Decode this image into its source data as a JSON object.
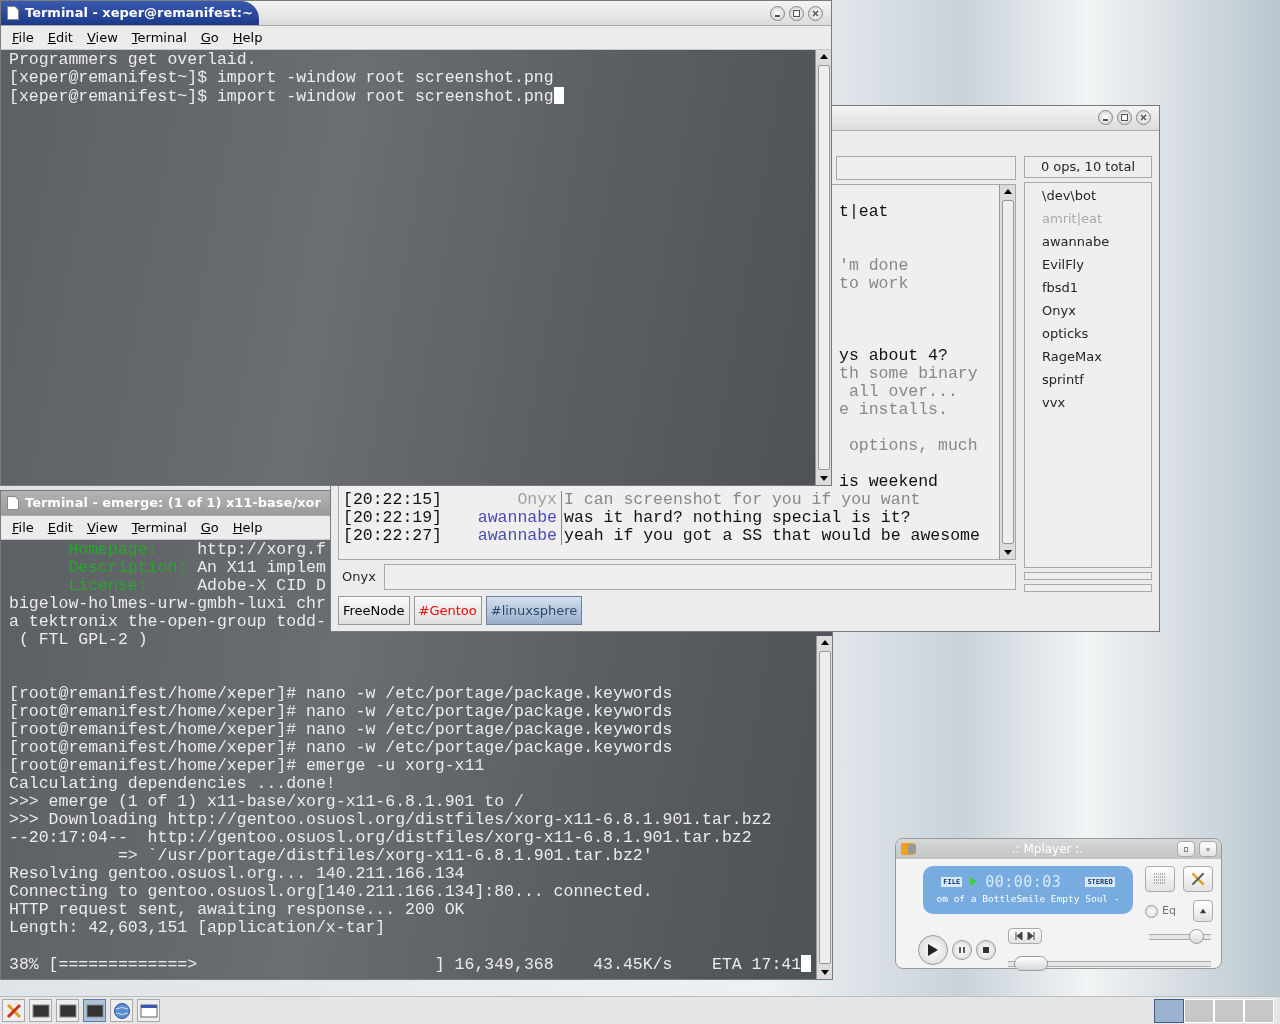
{
  "terminal_top": {
    "title": "Terminal - xeper@remanifest:~",
    "active": true,
    "menu": [
      "File",
      "Edit",
      "View",
      "Terminal",
      "Go",
      "Help"
    ],
    "lines": [
      {
        "kind": "text",
        "text": "Programmers get overlaid.",
        "cursor": false
      },
      {
        "kind": "text",
        "text": "[xeper@remanifest~]$ import -window root screenshot.png",
        "cursor": false
      },
      {
        "kind": "text",
        "text": "[xeper@remanifest~]$ import -window root screenshot.png",
        "cursor": true
      }
    ]
  },
  "irc": {
    "user_count": "0 ops, 10 total",
    "users": [
      {
        "name": "\\dev\\bot",
        "away": false
      },
      {
        "name": "amrit|eat",
        "away": true
      },
      {
        "name": "awannabe",
        "away": false
      },
      {
        "name": "EvilFly",
        "away": false
      },
      {
        "name": "fbsd1",
        "away": false
      },
      {
        "name": "Onyx",
        "away": false
      },
      {
        "name": "opticks",
        "away": false
      },
      {
        "name": "RageMax",
        "away": false
      },
      {
        "name": "sprintf",
        "away": false
      },
      {
        "name": "vvx",
        "away": false
      }
    ],
    "lines": [
      {
        "kind": "blank"
      },
      {
        "kind": "fragment",
        "text": "t|eat",
        "dim": false
      },
      {
        "kind": "blank"
      },
      {
        "kind": "blank"
      },
      {
        "kind": "fragment",
        "text": "'m done",
        "dim": true
      },
      {
        "kind": "fragment",
        "text": "to work",
        "dim": true
      },
      {
        "kind": "blank"
      },
      {
        "kind": "blank"
      },
      {
        "kind": "blank"
      },
      {
        "kind": "fragment",
        "text": "ys about 4?",
        "dim": false
      },
      {
        "kind": "fragment",
        "text": "th some binary",
        "dim": true
      },
      {
        "kind": "fragment",
        "text": " all over...",
        "dim": true
      },
      {
        "kind": "fragment",
        "text": "e installs.",
        "dim": true
      },
      {
        "kind": "blank"
      },
      {
        "kind": "fragment",
        "text": " options, much",
        "dim": true
      },
      {
        "kind": "blank"
      },
      {
        "kind": "fragment",
        "text": "is weekend",
        "dim": false
      },
      {
        "kind": "message",
        "time": "[20:22:15]",
        "nick": "Onyx",
        "color": "#a0a0a0",
        "text": "I can screenshot for you if you want",
        "dim": true
      },
      {
        "kind": "message",
        "time": "[20:22:19]",
        "nick": "awannabe",
        "color": "#4a4ab8",
        "text": "was it hard? nothing special is it?",
        "dim": false
      },
      {
        "kind": "message",
        "time": "[20:22:27]",
        "nick": "awannabe",
        "color": "#4a4ab8",
        "text": "yeah if you got a SS that would be awesome",
        "dim": false
      }
    ],
    "input_nick": "Onyx",
    "tabs": [
      {
        "label": "FreeNode",
        "selected": false,
        "color": "#000000"
      },
      {
        "label": "#Gentoo",
        "selected": false,
        "color": "#ff0000"
      },
      {
        "label": "#linuxsphere",
        "selected": true,
        "color": "#2c4a6e"
      }
    ]
  },
  "terminal_bottom": {
    "title": "Terminal - emerge: (1 of 1) x11-base/xor",
    "active": false,
    "menu": [
      "File",
      "Edit",
      "View",
      "Terminal",
      "Go",
      "Help"
    ],
    "lines": [
      {
        "kind": "field",
        "label": "Homepage:",
        "value": "http://xorg.f"
      },
      {
        "kind": "field",
        "label": "Description:",
        "value": "An X11 implem"
      },
      {
        "kind": "field",
        "label": "License:",
        "value": "Adobe-X CID D"
      },
      {
        "kind": "text",
        "text": "bigelow-holmes-urw-gmbh-luxi chr",
        "cursor": false
      },
      {
        "kind": "text",
        "text": "a tektronix the-open-group todd-",
        "cursor": false
      },
      {
        "kind": "text",
        "text": " ( FTL GPL-2 )",
        "cursor": false
      },
      {
        "kind": "blank"
      },
      {
        "kind": "blank"
      },
      {
        "kind": "text",
        "text": "[root@remanifest/home/xeper]# nano -w /etc/portage/package.keywords",
        "cursor": false
      },
      {
        "kind": "text",
        "text": "[root@remanifest/home/xeper]# nano -w /etc/portage/package.keywords",
        "cursor": false
      },
      {
        "kind": "text",
        "text": "[root@remanifest/home/xeper]# nano -w /etc/portage/package.keywords",
        "cursor": false
      },
      {
        "kind": "text",
        "text": "[root@remanifest/home/xeper]# nano -w /etc/portage/package.keywords",
        "cursor": false
      },
      {
        "kind": "text",
        "text": "[root@remanifest/home/xeper]# emerge -u xorg-x11",
        "cursor": false
      },
      {
        "kind": "text",
        "text": "Calculating dependencies ...done!",
        "cursor": false
      },
      {
        "kind": "text",
        "text": ">>> emerge (1 of 1) x11-base/xorg-x11-6.8.1.901 to /",
        "cursor": false
      },
      {
        "kind": "text",
        "text": ">>> Downloading http://gentoo.osuosl.org/distfiles/xorg-x11-6.8.1.901.tar.bz2",
        "cursor": false
      },
      {
        "kind": "text",
        "text": "--20:17:04--  http://gentoo.osuosl.org/distfiles/xorg-x11-6.8.1.901.tar.bz2",
        "cursor": false
      },
      {
        "kind": "text",
        "text": "           => `/usr/portage/distfiles/xorg-x11-6.8.1.901.tar.bz2'",
        "cursor": false
      },
      {
        "kind": "text",
        "text": "Resolving gentoo.osuosl.org... 140.211.166.134",
        "cursor": false
      },
      {
        "kind": "text",
        "text": "Connecting to gentoo.osuosl.org[140.211.166.134]:80... connected.",
        "cursor": false
      },
      {
        "kind": "text",
        "text": "HTTP request sent, awaiting response... 200 OK",
        "cursor": false
      },
      {
        "kind": "text",
        "text": "Length: 42,603,151 [application/x-tar]",
        "cursor": false
      },
      {
        "kind": "blank"
      },
      {
        "kind": "text",
        "text": "38% [=============>                        ] 16,349,368    43.45K/s    ETA 17:41",
        "cursor": true
      }
    ]
  },
  "mplayer": {
    "title": ".: Mplayer :.",
    "source": "FILE",
    "time": "00:00:03",
    "channels": "STEREO",
    "song": "om of a BottleSmile Empty Soul -",
    "eq": {
      "label": "Eq",
      "checked": false
    },
    "volume": {
      "level": 0.78
    },
    "position": {
      "level": 0.03
    }
  },
  "taskbar": {
    "items": [
      {
        "kind": "tools",
        "selected": false
      },
      {
        "kind": "terminal",
        "selected": false
      },
      {
        "kind": "terminal",
        "selected": false
      },
      {
        "kind": "terminal",
        "selected": true
      },
      {
        "kind": "globe",
        "selected": false
      },
      {
        "kind": "window",
        "selected": false
      }
    ],
    "desktops": [
      {
        "selected": true
      },
      {
        "selected": false
      },
      {
        "selected": false
      },
      {
        "selected": false
      }
    ]
  }
}
